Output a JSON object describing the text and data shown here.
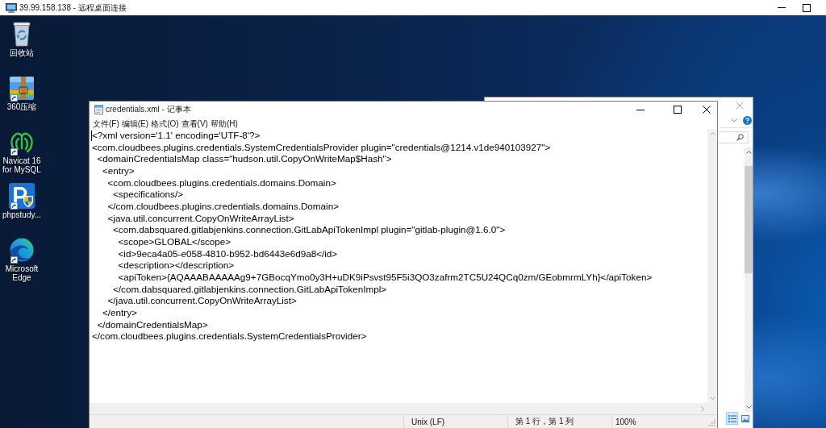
{
  "remote_desktop": {
    "title": "39.99.158.138 - 远程桌面连接"
  },
  "desktop_icons": [
    {
      "kind": "recycle-bin",
      "label": "回收站",
      "shortcut": false
    },
    {
      "kind": "zip-folder",
      "label": "360压缩",
      "shortcut": true
    },
    {
      "kind": "outline-logo",
      "label": "Navicat 16 for MySQL",
      "shortcut": true
    },
    {
      "kind": "p-shield",
      "label": "phpstudy...",
      "shortcut": true
    },
    {
      "kind": "swirl",
      "label": "Microsoft Edge",
      "shortcut": true
    }
  ],
  "background_window": {
    "view_buttons": [
      {
        "kind": "details",
        "selected": true
      },
      {
        "kind": "large-icons",
        "selected": false
      }
    ]
  },
  "notepad": {
    "title": "credentials.xml - 记事本",
    "menu": [
      "文件(F)",
      "编辑(E)",
      "格式(O)",
      "查看(V)",
      "帮助(H)"
    ],
    "lines": [
      "<?xml version='1.1' encoding='UTF-8'?>",
      "<com.cloudbees.plugins.credentials.SystemCredentialsProvider plugin=\"credentials@1214.v1de940103927\">",
      "  <domainCredentialsMap class=\"hudson.util.CopyOnWriteMap$Hash\">",
      "    <entry>",
      "      <com.cloudbees.plugins.credentials.domains.Domain>",
      "        <specifications/>",
      "      </com.cloudbees.plugins.credentials.domains.Domain>",
      "      <java.util.concurrent.CopyOnWriteArrayList>",
      "        <com.dabsquared.gitlabjenkins.connection.GitLabApiTokenImpl plugin=\"gitlab-plugin@1.6.0\">",
      "          <scope>GLOBAL</scope>",
      "          <id>9eca4a05-e058-4810-b952-bd6443e6d9a8</id>",
      "          <description></description>",
      "          <apiToken>{AQAAABAAAAAg9+7GBocqYmo0y3H+uDK9iPsvst95F5i3QO3zafrm2TC5U24QCq0zm/GEobmrmLYh}</apiToken>",
      "        </com.dabsquared.gitlabjenkins.connection.GitLabApiTokenImpl>",
      "      </java.util.concurrent.CopyOnWriteArrayList>",
      "    </entry>",
      "  </domainCredentialsMap>",
      "</com.cloudbees.plugins.credentials.SystemCredentialsProvider>"
    ],
    "status_bar": {
      "line_ending": "Unix (LF)",
      "position": "第 1 行，第 1 列",
      "zoom": "100%"
    }
  }
}
